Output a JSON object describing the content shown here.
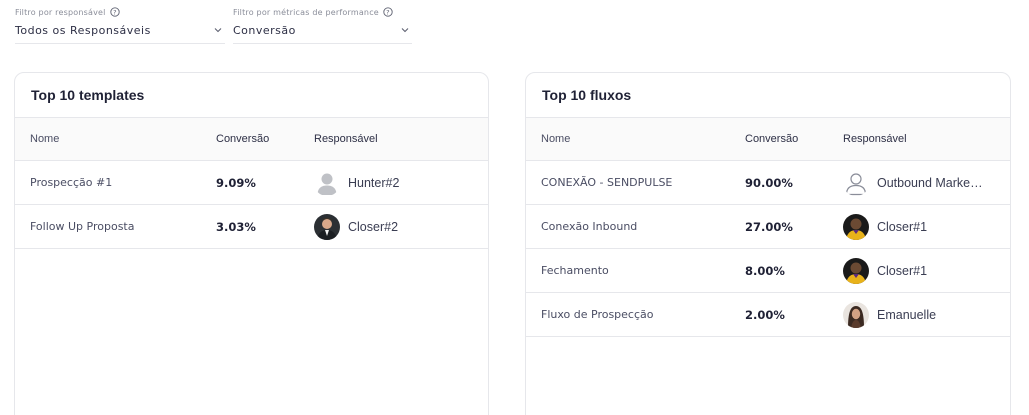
{
  "filters": {
    "responsible": {
      "label": "Filtro por responsável",
      "value": "Todos os Responsáveis"
    },
    "metric": {
      "label": "Filtro por métricas de performance",
      "value": "Conversão"
    }
  },
  "templates": {
    "title": "Top 10 templates",
    "columns": [
      "Nome",
      "Conversão",
      "Responsável"
    ],
    "rows": [
      {
        "name": "Prospecção #1",
        "conversion": "9.09%",
        "responsible": "Hunter#2",
        "avatar": "default-person-avatar"
      },
      {
        "name": "Follow Up Proposta",
        "conversion": "3.03%",
        "responsible": "Closer#2",
        "avatar": "photo-avatar"
      }
    ]
  },
  "flows": {
    "title": "Top 10 fluxos",
    "columns": [
      "Nome",
      "Conversão",
      "Responsável"
    ],
    "rows": [
      {
        "name": "CONEXÃO - SENDPULSE",
        "conversion": "90.00%",
        "responsible": "Outbound Marke…",
        "avatar": "outline-person-avatar"
      },
      {
        "name": "Conexão Inbound",
        "conversion": "27.00%",
        "responsible": "Closer#1",
        "avatar": "photo-avatar"
      },
      {
        "name": "Fechamento",
        "conversion": "8.00%",
        "responsible": "Closer#1",
        "avatar": "photo-avatar"
      },
      {
        "name": "Fluxo de Prospecção",
        "conversion": "2.00%",
        "responsible": "Emanuelle",
        "avatar": "photo-avatar"
      }
    ]
  },
  "colors": {
    "border": "#e6e7eb",
    "header_bg": "#fafafa",
    "text": "#2d2f45",
    "muted": "#8a8d99"
  }
}
